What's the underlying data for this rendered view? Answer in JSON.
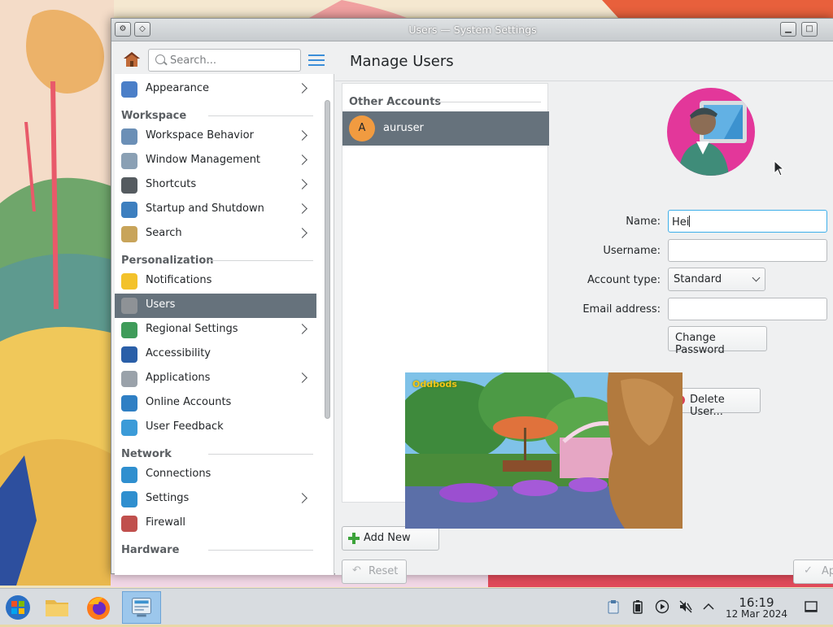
{
  "window": {
    "title": "Users — System Settings"
  },
  "sidebar": {
    "search_placeholder": "Search...",
    "items": [
      {
        "type": "item",
        "label": "Appearance",
        "icon": "appearance-icon",
        "chevron": true,
        "active": false
      },
      {
        "type": "category",
        "label": "Workspace"
      },
      {
        "type": "item",
        "label": "Workspace Behavior",
        "icon": "workspace-behavior-icon",
        "chevron": true,
        "active": false
      },
      {
        "type": "item",
        "label": "Window Management",
        "icon": "window-management-icon",
        "chevron": true,
        "active": false
      },
      {
        "type": "item",
        "label": "Shortcuts",
        "icon": "keyboard-icon",
        "chevron": true,
        "active": false
      },
      {
        "type": "item",
        "label": "Startup and Shutdown",
        "icon": "startup-icon",
        "chevron": true,
        "active": false
      },
      {
        "type": "item",
        "label": "Search",
        "icon": "search-settings-icon",
        "chevron": true,
        "active": false
      },
      {
        "type": "category",
        "label": "Personalization"
      },
      {
        "type": "item",
        "label": "Notifications",
        "icon": "bell-icon",
        "chevron": false,
        "active": false
      },
      {
        "type": "item",
        "label": "Users",
        "icon": "users-icon",
        "chevron": false,
        "active": true
      },
      {
        "type": "item",
        "label": "Regional Settings",
        "icon": "globe-icon",
        "chevron": true,
        "active": false
      },
      {
        "type": "item",
        "label": "Accessibility",
        "icon": "accessibility-icon",
        "chevron": false,
        "active": false
      },
      {
        "type": "item",
        "label": "Applications",
        "icon": "applications-icon",
        "chevron": true,
        "active": false
      },
      {
        "type": "item",
        "label": "Online Accounts",
        "icon": "online-accounts-icon",
        "chevron": false,
        "active": false
      },
      {
        "type": "item",
        "label": "User Feedback",
        "icon": "feedback-icon",
        "chevron": false,
        "active": false
      },
      {
        "type": "category",
        "label": "Network"
      },
      {
        "type": "item",
        "label": "Connections",
        "icon": "connections-icon",
        "chevron": false,
        "active": false
      },
      {
        "type": "item",
        "label": "Settings",
        "icon": "network-settings-icon",
        "chevron": true,
        "active": false
      },
      {
        "type": "item",
        "label": "Firewall",
        "icon": "firewall-icon",
        "chevron": false,
        "active": false
      },
      {
        "type": "category",
        "label": "Hardware"
      }
    ]
  },
  "main": {
    "title": "Manage Users",
    "accounts_category": "Other Accounts",
    "user": {
      "initial": "A",
      "name": "auruser"
    },
    "add_button": "Add New",
    "reset_button": "Reset",
    "apply_button": "Ap",
    "form": {
      "name_label": "Name:",
      "name_value": "Hei",
      "username_label": "Username:",
      "username_value": "",
      "account_type_label": "Account type:",
      "account_type_value": "Standard",
      "email_label": "Email address:",
      "email_value": "",
      "change_password": "Change Password",
      "delete_user": "Delete User..."
    }
  },
  "video_overlay": {
    "logo_text": "Oddbods"
  },
  "taskbar": {
    "time": "16:19",
    "date": "12 Mar 2024"
  },
  "colors": {
    "selection": "#66727c",
    "accent": "#3daee9",
    "avatar_ring": "#e3379a",
    "user_badge": "#f19b40"
  }
}
